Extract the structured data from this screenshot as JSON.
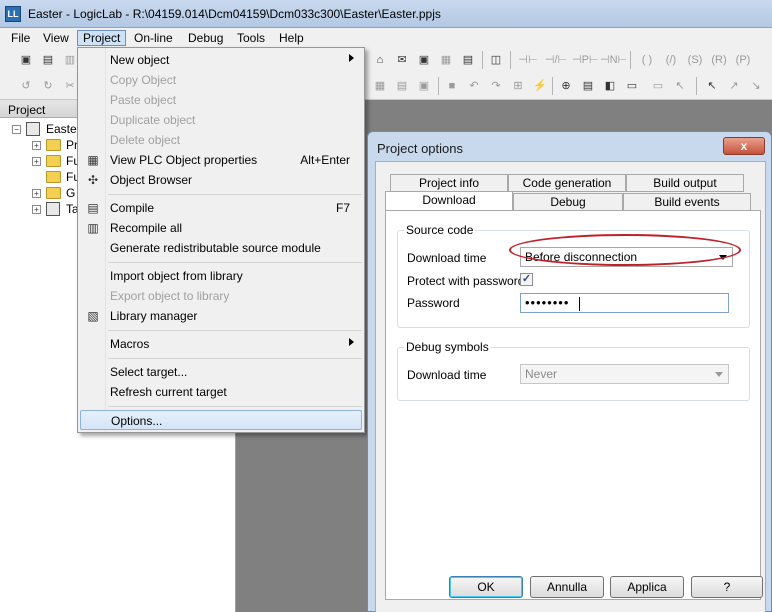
{
  "window": {
    "title": "Easter - LogicLab - R:\\04159.014\\Dcm04159\\Dcm033c300\\Easter\\Easter.ppjs",
    "app_icon": "LL"
  },
  "menubar": {
    "items": [
      "File",
      "View",
      "Project",
      "On-line",
      "Debug",
      "Tools",
      "Help"
    ]
  },
  "toolbar": {
    "row1": [
      "⌂",
      "✉",
      "▣",
      "▦",
      "▤",
      "◫",
      "▥",
      "▦",
      "▩",
      "▣",
      "⊣⊢",
      "⊣/⊢",
      "⊣P⊢",
      "⊣N⊢",
      "( )",
      "(/)",
      "(S)",
      "(R)",
      "(P)"
    ],
    "row2": [
      "↺",
      "↻",
      "⇌",
      "▦",
      "▤",
      "▣",
      "■",
      "↶",
      "↷",
      "⊞",
      "⚡",
      "⊕",
      "▤",
      "◧",
      "▭",
      "▭",
      "↖",
      "↗",
      "↘",
      "↙"
    ]
  },
  "project_panel": {
    "header": "Project",
    "tree": [
      {
        "label": "Easte",
        "level": 0,
        "icon": "project-icon"
      },
      {
        "label": "Pr",
        "level": 1,
        "icon": "folder-icon"
      },
      {
        "label": "Fu",
        "level": 1,
        "icon": "folder-icon"
      },
      {
        "label": "Fu",
        "level": 1,
        "icon": "folder-icon"
      },
      {
        "label": "G",
        "level": 1,
        "icon": "folder-icon"
      },
      {
        "label": "Ta",
        "level": 1,
        "icon": "project-icon"
      }
    ]
  },
  "project_menu": {
    "items": [
      {
        "label": "New object",
        "submenu": true,
        "disabled": false,
        "shortcut": "",
        "icon": ""
      },
      {
        "label": "Copy Object",
        "disabled": true,
        "shortcut": "",
        "icon": ""
      },
      {
        "label": "Paste object",
        "disabled": true,
        "shortcut": "",
        "icon": ""
      },
      {
        "label": "Duplicate object",
        "disabled": true,
        "shortcut": "",
        "icon": ""
      },
      {
        "label": "Delete object",
        "disabled": true,
        "shortcut": "",
        "icon": ""
      },
      {
        "label": "View PLC Object properties",
        "disabled": false,
        "shortcut": "Alt+Enter",
        "icon": "▦"
      },
      {
        "label": "Object Browser",
        "disabled": false,
        "shortcut": "",
        "icon": "✣"
      },
      {
        "label": "Compile",
        "disabled": false,
        "shortcut": "F7",
        "icon": "▤"
      },
      {
        "label": "Recompile all",
        "disabled": false,
        "shortcut": "",
        "icon": "▥"
      },
      {
        "label": "Generate redistributable source module",
        "disabled": false,
        "shortcut": "",
        "icon": ""
      },
      {
        "label": "Import object from library",
        "disabled": false,
        "shortcut": "",
        "icon": ""
      },
      {
        "label": "Export object to library",
        "disabled": true,
        "shortcut": "",
        "icon": ""
      },
      {
        "label": "Library manager",
        "disabled": false,
        "shortcut": "",
        "icon": "▧"
      },
      {
        "label": "Macros",
        "submenu": true,
        "disabled": false,
        "shortcut": "",
        "icon": ""
      },
      {
        "label": "Select target...",
        "disabled": false,
        "shortcut": "",
        "icon": ""
      },
      {
        "label": "Refresh current target",
        "disabled": false,
        "shortcut": "",
        "icon": ""
      },
      {
        "label": "Options...",
        "disabled": false,
        "shortcut": "",
        "icon": "",
        "highlight": true
      }
    ]
  },
  "dialog": {
    "title": "Project options",
    "close_label": "x",
    "tabs_back": [
      "Project info",
      "Code generation",
      "Build output"
    ],
    "tabs_front": [
      "Download",
      "Debug",
      "Build events"
    ],
    "selected_tab": "Download",
    "source_code": {
      "legend": "Source code",
      "download_time_label": "Download time",
      "download_time_value": "Before disconnection",
      "protect_label": "Protect with password",
      "protect_checked": "✓",
      "password_label": "Password",
      "password_value": "••••••••"
    },
    "debug_symbols": {
      "legend": "Debug symbols",
      "download_time_label": "Download time",
      "download_time_value": "Never"
    },
    "buttons": {
      "ok": "OK",
      "cancel": "Annulla",
      "apply": "Applica",
      "help": "?"
    }
  },
  "colors": {
    "highlight_ellipse": "#c0202a",
    "menu_active": "#cde2f7"
  }
}
